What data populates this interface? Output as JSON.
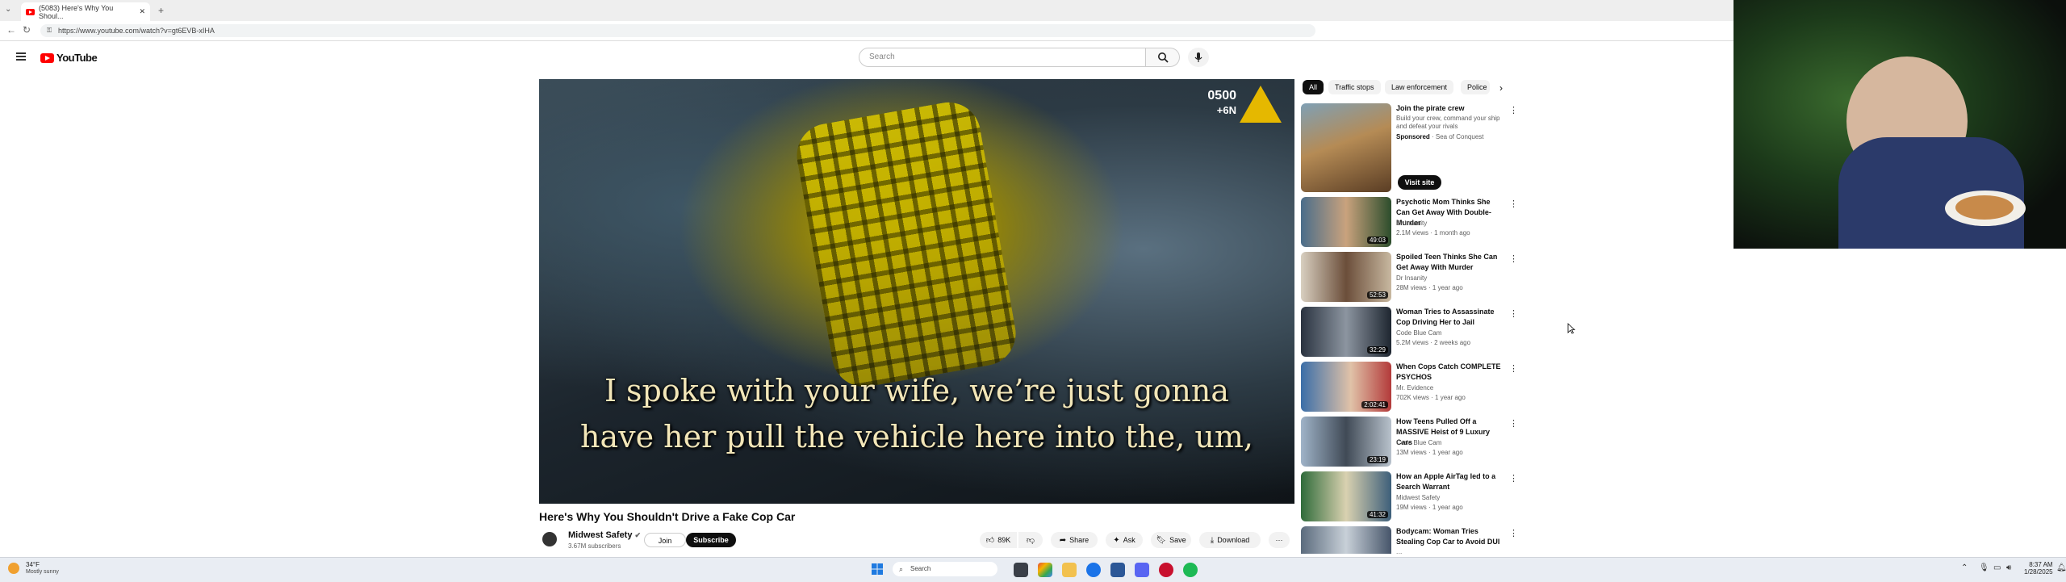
{
  "browser": {
    "tab_title": "(5083) Here's Why You Shoul...",
    "url": "https://www.youtube.com/watch?v=gt6EVB-xIHA"
  },
  "youtube": {
    "logo_text": "YouTube",
    "search_placeholder": "Search"
  },
  "video": {
    "counter_top": "0500",
    "counter_bottom": "+6N",
    "caption_line1": "I spoke with your wife, we’re just gonna",
    "caption_line2": "have her pull the vehicle here into the, um,",
    "title": "Here's Why You Shouldn't Drive a Fake Cop Car",
    "channel": "Midwest Safety",
    "subscribers": "3.67M subscribers",
    "join_label": "Join",
    "subscribe_label": "Subscribe",
    "likes": "89K",
    "share_label": "Share",
    "ask_label": "Ask",
    "save_label": "Save",
    "download_label": "Download",
    "more_label": "···"
  },
  "sidebar": {
    "chips": [
      "All",
      "Traffic stops",
      "Law enforcement",
      "Police"
    ],
    "sponsored": {
      "title": "Join the pirate crew",
      "desc1": "Build your crew, command your ship",
      "desc2": "and defeat your rivals",
      "sponsored_label": "Sponsored",
      "advertiser": "Sea of Conquest",
      "cta": "Visit site"
    },
    "videos": [
      {
        "title": "Psychotic Mom Thinks She Can Get Away With Double-Murder",
        "channel": "Dr Insanity",
        "meta": "2.1M views · 1 month ago",
        "duration": "49:03"
      },
      {
        "title": "Spoiled Teen Thinks She Can Get Away With Murder",
        "channel": "Dr Insanity",
        "meta": "28M views · 1 year ago",
        "duration": "52:53"
      },
      {
        "title": "Woman Tries to Assassinate Cop Driving Her to Jail",
        "channel": "Code Blue Cam",
        "meta": "5.2M views · 2 weeks ago",
        "duration": "32:29"
      },
      {
        "title": "When Cops Catch COMPLETE PSYCHOS",
        "channel": "Mr. Evidence",
        "meta": "702K views · 1 year ago",
        "duration": "2:02:41"
      },
      {
        "title": "How Teens Pulled Off a MASSIVE Heist of 9 Luxury Cars",
        "channel": "Code Blue Cam",
        "meta": "13M views · 1 year ago",
        "duration": "23:19"
      },
      {
        "title": "How an Apple AirTag led to a Search Warrant",
        "channel": "Midwest Safety",
        "meta": "19M views · 1 year ago",
        "duration": "41:32"
      },
      {
        "title": "Bodycam: Woman Tries Stealing Cop Car to Avoid DUI ...",
        "channel": "",
        "meta": "",
        "duration": ""
      }
    ]
  },
  "taskbar": {
    "weather_temp": "34°F",
    "weather_desc": "Mostly sunny",
    "search_label": "Search",
    "time": "8:37 AM",
    "date": "1/28/2025"
  },
  "colors": {
    "youtube_red": "#ff0000",
    "caption": "#f2e6b8",
    "video_logo": "#e5b800"
  }
}
